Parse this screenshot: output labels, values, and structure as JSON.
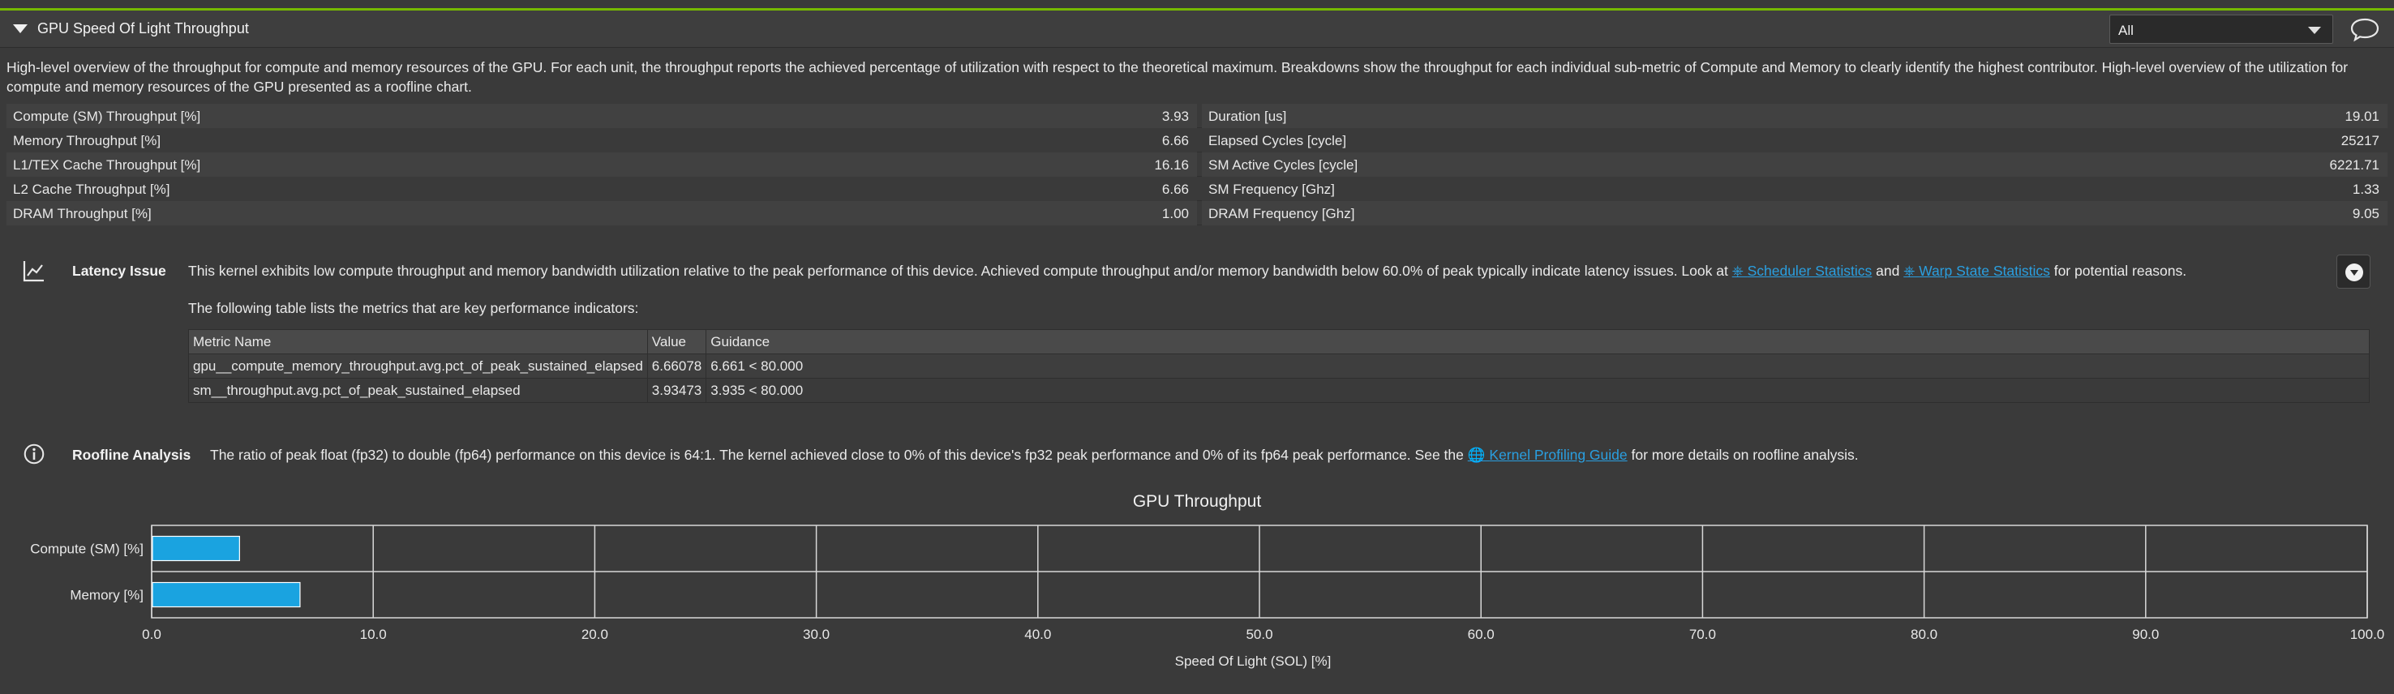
{
  "header": {
    "title": "GPU Speed Of Light Throughput",
    "filter_value": "All"
  },
  "description": "High-level overview of the throughput for compute and memory resources of the GPU. For each unit, the throughput reports the achieved percentage of utilization with respect to the theoretical maximum. Breakdowns show the throughput for each individual sub-metric of Compute and Memory to clearly identify the highest contributor. High-level overview of the utilization for compute and memory resources of the GPU presented as a roofline chart.",
  "metrics": [
    {
      "left_label": "Compute (SM) Throughput [%]",
      "left_value": "3.93",
      "right_label": "Duration [us]",
      "right_value": "19.01"
    },
    {
      "left_label": "Memory Throughput [%]",
      "left_value": "6.66",
      "right_label": "Elapsed Cycles [cycle]",
      "right_value": "25217"
    },
    {
      "left_label": "L1/TEX Cache Throughput [%]",
      "left_value": "16.16",
      "right_label": "SM Active Cycles [cycle]",
      "right_value": "6221.71"
    },
    {
      "left_label": "L2 Cache Throughput [%]",
      "left_value": "6.66",
      "right_label": "SM Frequency [Ghz]",
      "right_value": "1.33"
    },
    {
      "left_label": "DRAM Throughput [%]",
      "left_value": "1.00",
      "right_label": "DRAM Frequency [Ghz]",
      "right_value": "9.05"
    }
  ],
  "latency_issue": {
    "title": "Latency Issue",
    "text_before": "This kernel exhibits low compute throughput and memory bandwidth utilization relative to the peak performance of this device. Achieved compute throughput and/or memory bandwidth below 60.0% of peak typically indicate latency issues. Look at ",
    "link1": "Scheduler Statistics",
    "text_mid": " and ",
    "link2": "Warp State Statistics",
    "text_after": " for potential reasons.",
    "table_intro": "The following table lists the metrics that are key performance indicators:",
    "table_headers": [
      "Metric Name",
      "Value",
      "Guidance"
    ],
    "table_rows": [
      [
        "gpu__compute_memory_throughput.avg.pct_of_peak_sustained_elapsed",
        "6.66078",
        "6.661 < 80.000"
      ],
      [
        "sm__throughput.avg.pct_of_peak_sustained_elapsed",
        "3.93473",
        "3.935 < 80.000"
      ]
    ]
  },
  "roofline": {
    "title": "Roofline Analysis",
    "text_before": "The ratio of peak float (fp32) to double (fp64) performance on this device is 64:1. The kernel achieved close to 0% of this device's fp32 peak performance and 0% of its fp64 peak performance. See the ",
    "link": "Kernel Profiling Guide",
    "text_after": " for more details on roofline analysis."
  },
  "chart_data": {
    "type": "bar",
    "orientation": "horizontal",
    "title": "GPU Throughput",
    "categories": [
      "Compute (SM) [%]",
      "Memory [%]"
    ],
    "values": [
      3.93,
      6.66
    ],
    "xlabel": "Speed Of Light (SOL) [%]",
    "ylabel": "",
    "xlim": [
      0,
      100
    ],
    "xticks": [
      "0.0",
      "10.0",
      "20.0",
      "30.0",
      "40.0",
      "50.0",
      "60.0",
      "70.0",
      "80.0",
      "90.0",
      "100.0"
    ],
    "grid": true,
    "bar_color": "#1aa3e0"
  }
}
